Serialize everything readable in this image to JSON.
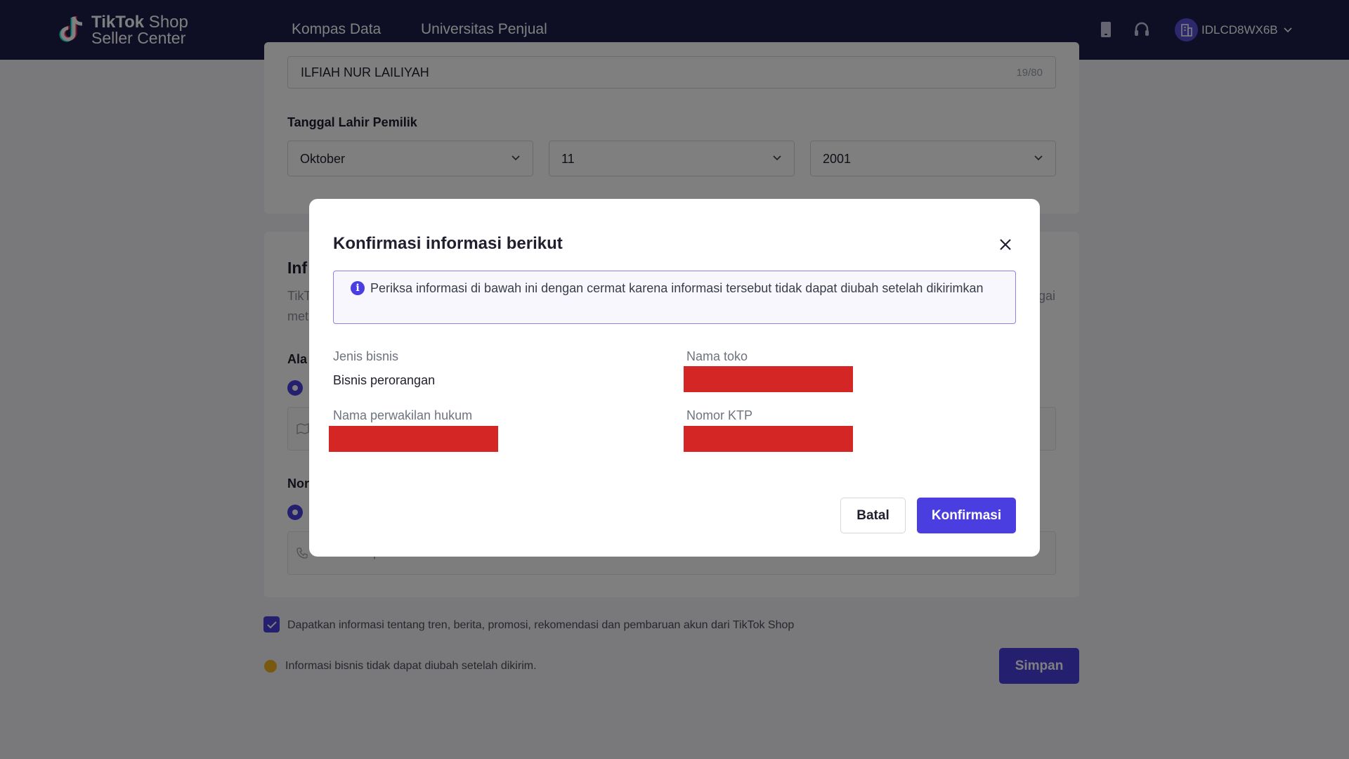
{
  "header": {
    "logo_line1_bold": "TikTok",
    "logo_line1_rest": " Shop",
    "logo_line2": "Seller Center",
    "nav": [
      "Kompas Data",
      "Universitas Penjual"
    ],
    "account_id": "IDLCD8WX6B",
    "icons": [
      "mobile-icon",
      "headset-icon",
      "shop-avatar-icon",
      "chevron-down-icon"
    ]
  },
  "form": {
    "owner_name_value": "ILFIAH NUR LAILIYAH",
    "owner_name_counter": "19/80",
    "birth_date_label": "Tanggal Lahir Pemilik",
    "birth_month": "Oktober",
    "birth_day": "11",
    "birth_year": "2001",
    "section_heading_partial": "Inf",
    "desc_partial_1": "TikT",
    "desc_partial_2": "met",
    "desc_partial_right": "gai",
    "address_label_partial": "Ala",
    "phone_label_partial": "Nor",
    "phone_placeholder_partial": "Nomor telepon +628 **** 0188"
  },
  "footer": {
    "subscribe_text": "Dapatkan informasi tentang tren, berita, promosi, rekomendasi dan pembaruan akun dari TikTok Shop",
    "subscribe_checked": true,
    "warning_text": "Informasi bisnis tidak dapat diubah setelah dikirim.",
    "save_label": "Simpan"
  },
  "modal": {
    "title": "Konfirmasi informasi berikut",
    "alert_icon": "i",
    "alert_text": "Periksa informasi di bawah ini dengan cermat karena informasi tersebut tidak dapat diubah setelah dikirimkan",
    "fields": {
      "business_type_label": "Jenis bisnis",
      "business_type_value": "Bisnis perorangan",
      "shop_name_label": "Nama toko",
      "legal_rep_label": "Nama perwakilan hukum",
      "ktp_label": "Nomor KTP"
    },
    "cancel_label": "Batal",
    "confirm_label": "Konfirmasi"
  },
  "colors": {
    "nav_bg": "#1c1d4b",
    "primary": "#4b3ee0",
    "redaction": "#d42725",
    "warning": "#f2b21f"
  }
}
